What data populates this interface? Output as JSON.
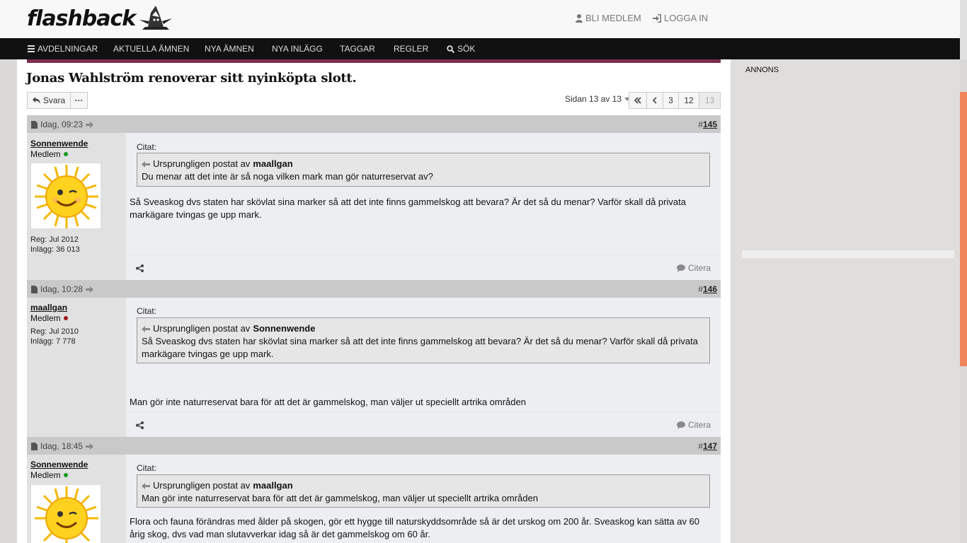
{
  "header": {
    "logo_text": "flashback",
    "join_label": "BLI MEDLEM",
    "login_label": "LOGGA IN"
  },
  "nav": {
    "items": [
      "AVDELNINGAR",
      "AKTUELLA ÄMNEN",
      "NYA ÄMNEN",
      "NYA INLÄGG",
      "TAGGAR",
      "REGLER",
      "SÖK"
    ]
  },
  "thread": {
    "title": "Jonas Wahlström renoverar sitt nyinköpta slott.",
    "reply_label": "Svara",
    "more_label": "···",
    "page_info": "Sidan 13 av 13",
    "pages": [
      "3",
      "12",
      "13"
    ],
    "current_page": "13"
  },
  "posts": [
    {
      "date": "Idag, 09:23",
      "hash": "#",
      "number": "145",
      "user": "Sonnenwende",
      "role": "Medlem",
      "online": true,
      "reg": "Reg: Jul 2012",
      "posts": "Inlägg: 36 013",
      "quote_label": "Citat:",
      "quote_prefix": "Ursprungligen postat av",
      "quote_author": "maallgan",
      "quote_text": "Du menar att det inte är så noga vilken mark man gör naturreservat av?",
      "text": "Så Sveaskog dvs staten har skövlat sina marker så att det inte finns gammelskog att bevara? Är det så du menar? Varför skall då privata markägare tvingas ge upp mark.",
      "cite_label": "Citera"
    },
    {
      "date": "Idag, 10:28",
      "hash": "#",
      "number": "146",
      "user": "maallgan",
      "role": "Medlem",
      "online": false,
      "reg": "Reg: Jul 2010",
      "posts": "Inlägg: 7 778",
      "quote_label": "Citat:",
      "quote_prefix": "Ursprungligen postat av",
      "quote_author": "Sonnenwende",
      "quote_text": "Så Sveaskog dvs staten har skövlat sina marker så att det inte finns gammelskog att bevara? Är det så du menar? Varför skall då privata markägare tvingas ge upp mark.",
      "text": "Man gör inte naturreservat bara för att det är gammelskog, man väljer ut speciellt artrika områden",
      "cite_label": "Citera"
    },
    {
      "date": "Idag, 18:45",
      "hash": "#",
      "number": "147",
      "user": "Sonnenwende",
      "role": "Medlem",
      "online": true,
      "quote_label": "Citat:",
      "quote_prefix": "Ursprungligen postat av",
      "quote_author": "maallgan",
      "quote_text": "Man gör inte naturreservat bara för att det är gammelskog, man väljer ut speciellt artrika områden",
      "text": "Flora och fauna förändras med ålder på skogen, gör ett hygge till naturskyddsområde så är det urskog om 200 år. Sveaskog kan sätta av 60 årig skog, dvs vad man slutavverkar idag så är det gammelskog om 60 år."
    }
  ],
  "sidebar": {
    "ad_label": "ANNONS"
  },
  "icons": {
    "menu": "bars-icon",
    "user": "user-icon",
    "login": "sign-in-icon",
    "search": "search-icon",
    "reply": "reply-icon",
    "post": "file-icon",
    "link": "arrow-right-icon",
    "share": "share-icon",
    "cite": "comment-icon",
    "quote": "arrow-left-icon"
  },
  "colors": {
    "navbar": "#111111",
    "accent": "#7e2d4e",
    "online": "#1a9a22",
    "offline": "#a11a1a",
    "scroll_thumb": "#ef845b"
  }
}
